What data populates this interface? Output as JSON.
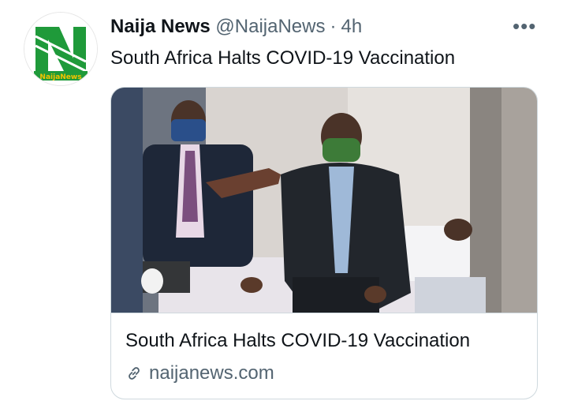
{
  "author": {
    "display_name": "Naija News",
    "handle": "@NaijaNews",
    "separator": "·",
    "time": "4h",
    "avatar_text": "NaijaNews"
  },
  "tweet": {
    "text": "South Africa Halts COVID-19 Vaccination"
  },
  "menu": {
    "more_label": "•••"
  },
  "card": {
    "title": "South Africa Halts COVID-19 Vaccination",
    "domain": "naijanews.com",
    "image_icon": "photo-of-vaccination-center"
  },
  "colors": {
    "text_primary": "#0f1419",
    "text_secondary": "#536471",
    "card_border": "#cfd9de",
    "brand_green": "#1f9a3a"
  }
}
